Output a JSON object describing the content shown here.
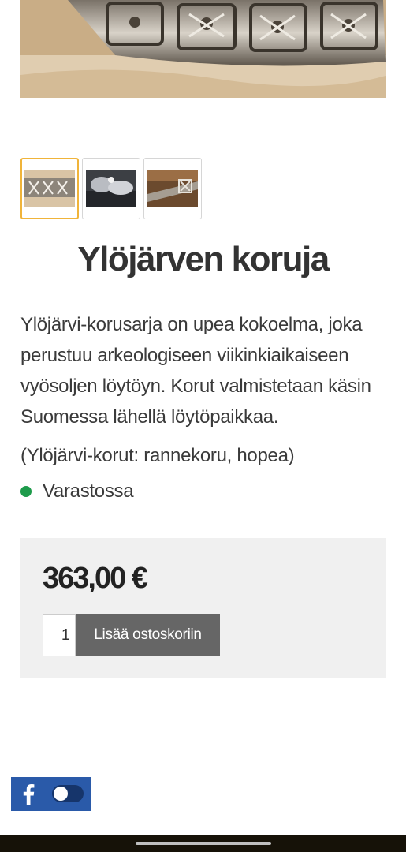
{
  "product": {
    "hero_image": "silver-bracelet-photo",
    "thumbnails": [
      {
        "icon": "bracelet-thumbnail",
        "active": true
      },
      {
        "icon": "bracelet-on-rock-thumbnail",
        "active": false
      },
      {
        "icon": "bracelet-detail-thumbnail",
        "active": false
      }
    ],
    "title": "Ylöjärven koruja",
    "description": "Ylöjärvi-korusarja on upea kokoelma, joka perustuu arkeologiseen viikinkiaikaiseen vyösoljen löytöyn. Korut valmistetaan käsin Suomessa lähellä löytöpaikkaa.",
    "meta": "(Ylöjärvi-korut: rannekoru, hopea)",
    "stock_status": "Varastossa",
    "stock_color": "#1e9b4b",
    "price": "363,00 €",
    "quantity": "1",
    "add_to_cart_label": "Lisää ostoskoriin",
    "accent_color": "#f0b43a"
  },
  "widgets": {
    "facebook_icon": "facebook-icon",
    "facebook_color": "#2a5aa9",
    "toggle_state": "off"
  }
}
